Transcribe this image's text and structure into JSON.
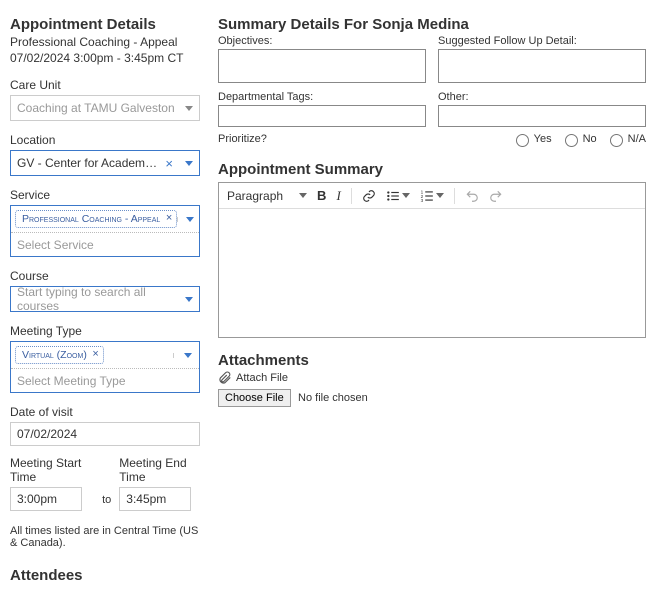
{
  "left": {
    "title": "Appointment Details",
    "subtitle1": "Professional Coaching - Appeal",
    "subtitle2": "07/02/2024 3:00pm - 3:45pm CT",
    "care_unit": {
      "label": "Care Unit",
      "value": "Coaching at TAMU Galveston"
    },
    "location": {
      "label": "Location",
      "value": "GV - Center for Academic Learning Support"
    },
    "service": {
      "label": "Service",
      "tag": "Professional Coaching - Appeal",
      "placeholder": "Select Service"
    },
    "course": {
      "label": "Course",
      "placeholder": "Start typing to search all courses"
    },
    "meeting_type": {
      "label": "Meeting Type",
      "tag": "Virtual (Zoom)",
      "placeholder": "Select Meeting Type"
    },
    "date_of_visit": {
      "label": "Date of visit",
      "value": "07/02/2024"
    },
    "start": {
      "label": "Meeting Start Time",
      "value": "3:00pm"
    },
    "to_word": "to",
    "end": {
      "label": "Meeting End Time",
      "value": "3:45pm"
    },
    "tz_note": "All times listed are in Central Time (US & Canada).",
    "attendees_title": "Attendees"
  },
  "right": {
    "title": "Summary Details For Sonja Medina",
    "objectives_label": "Objectives:",
    "followup_label": "Suggested Follow Up Detail:",
    "dept_label": "Departmental Tags:",
    "other_label": "Other:",
    "prioritize_label": "Prioritize?",
    "radio_yes": "Yes",
    "radio_no": "No",
    "radio_na": "N/A",
    "summary_title": "Appointment Summary",
    "paragraph_label": "Paragraph",
    "attachments_title": "Attachments",
    "attach_link": "Attach File",
    "choose_btn": "Choose File",
    "file_status": "No file chosen"
  }
}
